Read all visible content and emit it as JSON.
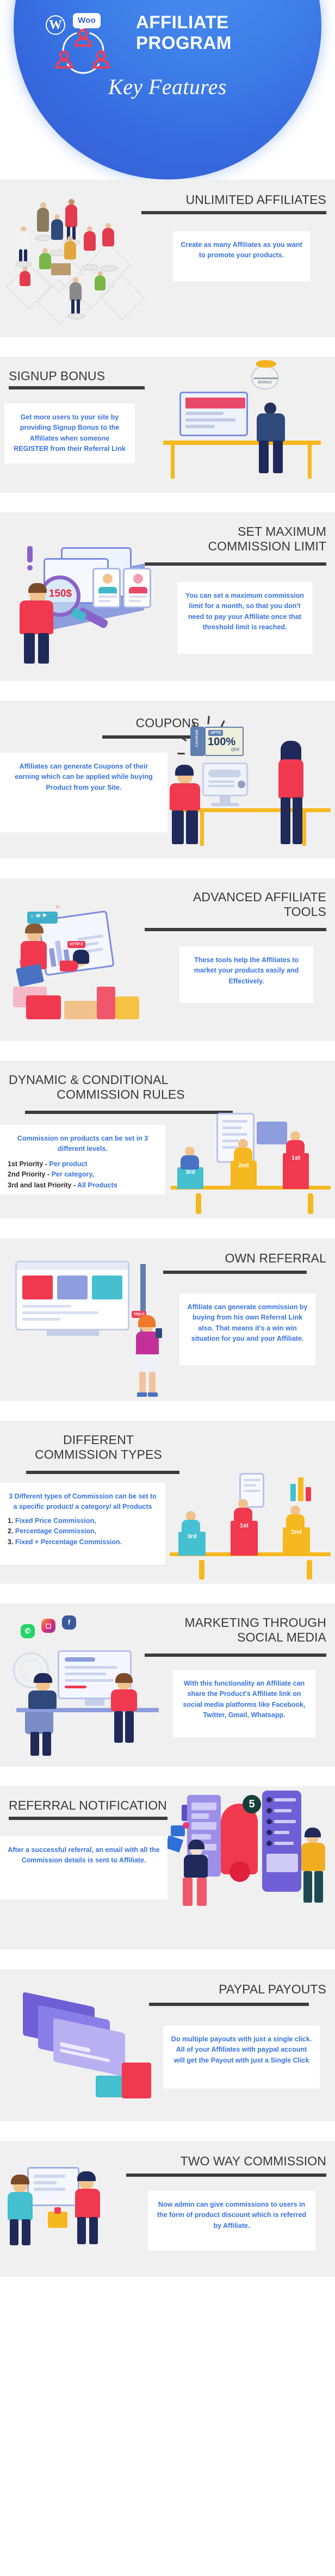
{
  "hero": {
    "wordpress_mark": "W",
    "woo_label": "Woo",
    "title_line1": "AFFILIATE",
    "title_line2": "PROGRAM",
    "subtitle": "Key Features",
    "bg_color": "#3d7ee8",
    "text_color": "#ffffff"
  },
  "theme": {
    "row_bg": "#f0f0f0",
    "page_bg": "#ffffff",
    "heading_color": "#393939",
    "body_color": "#3973dc",
    "accent_red": "#ef3e56",
    "accent_yellow": "#f6b81f",
    "accent_purple": "#8a7ee8"
  },
  "features": [
    {
      "id": "unlimited-affiliates",
      "title": "UNLIMITED AFFILIATES",
      "body": "Create as many Affiliates as you want to promote your products.",
      "art": "isometric-network-of-people"
    },
    {
      "id": "signup-bonus",
      "title": "SIGNUP BONUS",
      "body": "Get more users to your site by providing Signup Bonus to the Affiliates when someone REGISTER from their Referral Link",
      "art": "person-at-desk-with-bonus-bag",
      "art_label": "BONUS"
    },
    {
      "id": "set-maximum-commission-limit",
      "title_line1": "SET MAXIMUM",
      "title_line2": "COMMISSION LIMIT",
      "title": "SET MAXIMUM COMMISSION LIMIT",
      "body": "You can set a maximum commission limit for a month, so that you don't need to pay your Affiliate once that threshold limit is reached.",
      "art": "man-with-magnifier-on-profiles",
      "art_label": "150$"
    },
    {
      "id": "coupons",
      "title": "COUPONS",
      "body": "Affiliates can generate Coupons of their earning which can be applied while buying Product from your Site.",
      "art": "couple-at-desk-with-coupon",
      "art_label_top": "UPTO",
      "art_label_main": "100%",
      "art_label_sub": "OFF",
      "art_label_side": "COUPON"
    },
    {
      "id": "advanced-affiliate-tools",
      "title_line1": "ADVANCED AFFILIATE",
      "title_line2": "TOOLS",
      "title": "ADVANCED AFFILIATE TOOLS",
      "body": "These tools help the Affiliates to market your products easily and Effectively.",
      "art": "marketing-tools-dashboard",
      "art_label": "http://"
    },
    {
      "id": "dynamic-conditional-commission-rules",
      "title_line1": "DYNAMIC & CONDITIONAL",
      "title_line2": "COMMISSION RULES",
      "title": "DYNAMIC & CONDITIONAL COMMISSION RULES",
      "body_lead": "Commission on products can be set in 3 different levels.",
      "rules": [
        {
          "label": "1st Priority - ",
          "value": "Per product"
        },
        {
          "label": "2nd Priority - ",
          "value": "Per category,"
        },
        {
          "label": "3rd and last Priority - ",
          "value": "All Products"
        }
      ],
      "art": "podium-with-ranked-bars",
      "podium": [
        "3rd",
        "2nd",
        "1st"
      ]
    },
    {
      "id": "own-referral",
      "title": "OWN REFERRAL",
      "body": "Affiliate can generate commission by buying from his own Referral Link also. That means it's a win win situation for you and your Affiliate.",
      "art": "woman-with-phone-and-link",
      "art_label": "http://"
    },
    {
      "id": "different-commission-types",
      "title_line1": "DIFFERENT",
      "title_line2": "COMMISSION TYPES",
      "title": "DIFFERENT COMMISSION TYPES",
      "body_lead": "3 Different types of Commission can be set to a specific product/ a category/ all Products",
      "types": [
        {
          "num": "1. ",
          "value": "Fixed Price Commission,"
        },
        {
          "num": "2. ",
          "value": "Percentage Commission,"
        },
        {
          "num": "3. ",
          "value": "Fixed + Percentage Commission."
        }
      ],
      "art": "podium-winners-with-charts",
      "podium": [
        "3rd",
        "1st",
        "2nd"
      ]
    },
    {
      "id": "marketing-through-social-media",
      "title_line1": "MARKETING THROUGH",
      "title_line2": "SOCIAL MEDIA",
      "title": "MARKETING THROUGH SOCIAL MEDIA",
      "body": "With this functionality an Affiliate can share the Product's Affiliate link on social media platforms like Facebook, Twitter, Gmail, Whatsapp.",
      "art": "social-media-icons-and-desk",
      "social_icons": [
        "whatsapp-icon",
        "instagram-icon",
        "facebook-icon"
      ]
    },
    {
      "id": "referral-notification",
      "title": "REFERRAL NOTIFICATION",
      "body": "After a successful referral, an email with all the Commission details is sent to Affiliate.",
      "art": "notification-bell-with-phones",
      "badge_count": "5"
    },
    {
      "id": "paypal-payouts",
      "title": "PAYPAL PAYOUTS",
      "body": "Do multiple payouts with just a single click. All of your Affiliates with paypal account will get the Payout with just a Single Click",
      "art": "credit-cards-and-payout"
    },
    {
      "id": "two-way-commission",
      "title": "TWO WAY COMMISSION",
      "body": "Now admin can give commissions to users in the form of product discount which is referred by Affiliate.",
      "art": "two-people-exchange"
    }
  ]
}
